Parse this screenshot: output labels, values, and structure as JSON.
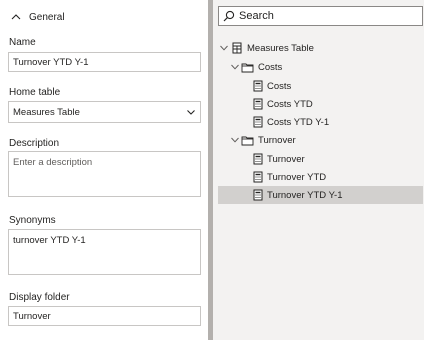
{
  "general": {
    "title": "General"
  },
  "name": {
    "label": "Name",
    "value": "Turnover YTD Y-1"
  },
  "home_table": {
    "label": "Home table",
    "value": "Measures Table"
  },
  "description": {
    "label": "Description",
    "placeholder": "Enter a description"
  },
  "synonyms": {
    "label": "Synonyms",
    "value": "turnover YTD Y-1"
  },
  "display_folder": {
    "label": "Display folder",
    "value": "Turnover"
  },
  "search": {
    "placeholder": "Search"
  },
  "tree": {
    "root": {
      "label": "Measures Table",
      "icon": "table-icon"
    },
    "folders": [
      {
        "label": "Costs",
        "icon": "folder-icon",
        "items": [
          "Costs",
          "Costs YTD",
          "Costs YTD Y-1"
        ]
      },
      {
        "label": "Turnover",
        "icon": "folder-icon",
        "items": [
          "Turnover",
          "Turnover YTD",
          "Turnover YTD Y-1"
        ]
      }
    ],
    "selected": "Turnover YTD Y-1"
  }
}
